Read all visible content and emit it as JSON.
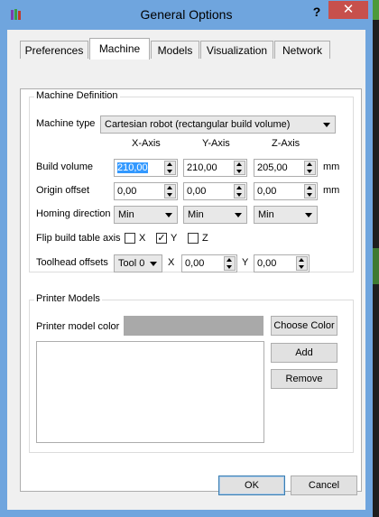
{
  "window": {
    "title": "General Options",
    "help": "?",
    "close": "✕"
  },
  "tabs": [
    "Preferences",
    "Machine",
    "Models",
    "Visualization",
    "Network"
  ],
  "machine_definition": {
    "title": "Machine Definition",
    "machine_type_label": "Machine type",
    "machine_type_value": "Cartesian robot (rectangular build volume)",
    "axis_headers": [
      "X-Axis",
      "Y-Axis",
      "Z-Axis"
    ],
    "build_volume_label": "Build volume",
    "build_volume": {
      "x_selected": "210,00",
      "y": "210,00",
      "z": "205,00"
    },
    "build_volume_unit": "mm",
    "origin_offset_label": "Origin offset",
    "origin_offset": {
      "x": "0,00",
      "y": "0,00",
      "z": "0,00"
    },
    "origin_offset_unit": "mm",
    "homing_label": "Homing direction",
    "homing": {
      "x": "Min",
      "y": "Min",
      "z": "Min"
    },
    "flip_label": "Flip build table axis",
    "flip": {
      "x_label": "X",
      "y_label": "Y",
      "z_label": "Z",
      "x_checked": false,
      "y_checked": true,
      "z_checked": false,
      "check_glyph": "✓"
    },
    "toolhead_label": "Toolhead offsets",
    "toolhead": {
      "tool": "Tool 0",
      "x_label": "X",
      "x": "0,00",
      "y_label": "Y",
      "y": "0,00"
    }
  },
  "printer_models": {
    "title": "Printer Models",
    "color_label": "Printer model color",
    "color": "#a9a9a9",
    "choose_color": "Choose Color",
    "add": "Add",
    "remove": "Remove"
  },
  "footer": {
    "ok": "OK",
    "cancel": "Cancel"
  }
}
